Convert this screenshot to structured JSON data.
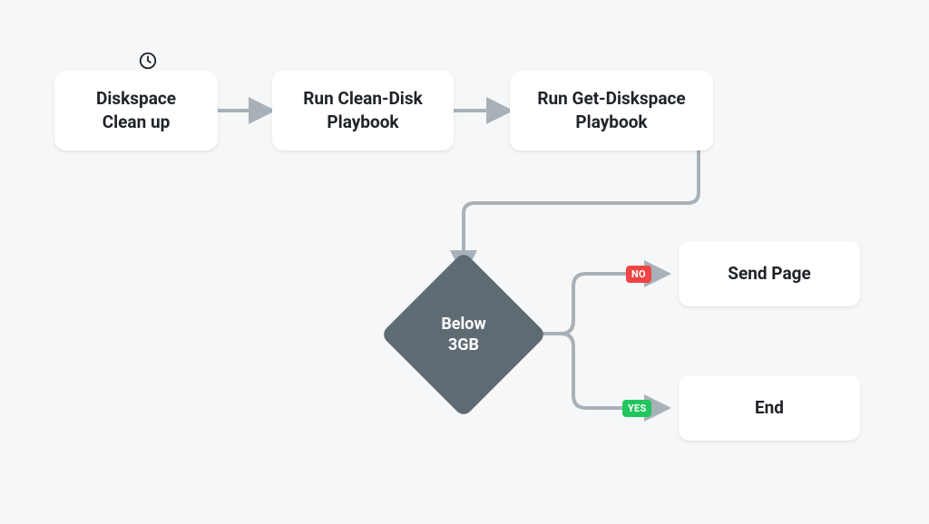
{
  "flow": {
    "start": {
      "line1": "Diskspace",
      "line2": "Clean up"
    },
    "step1": {
      "line1": "Run Clean-Disk",
      "line2": "Playbook"
    },
    "step2": {
      "line1": "Run Get-Diskspace",
      "line2": "Playbook"
    },
    "decision": {
      "line1": "Below",
      "line2": "3GB"
    },
    "no_tag": "NO",
    "yes_tag": "YES",
    "outcome_no": "Send Page",
    "outcome_yes": "End"
  },
  "colors": {
    "arrow": "#a9b1b8",
    "diamond": "#5f6b73",
    "no": "#ef4444",
    "yes": "#22c55e"
  }
}
